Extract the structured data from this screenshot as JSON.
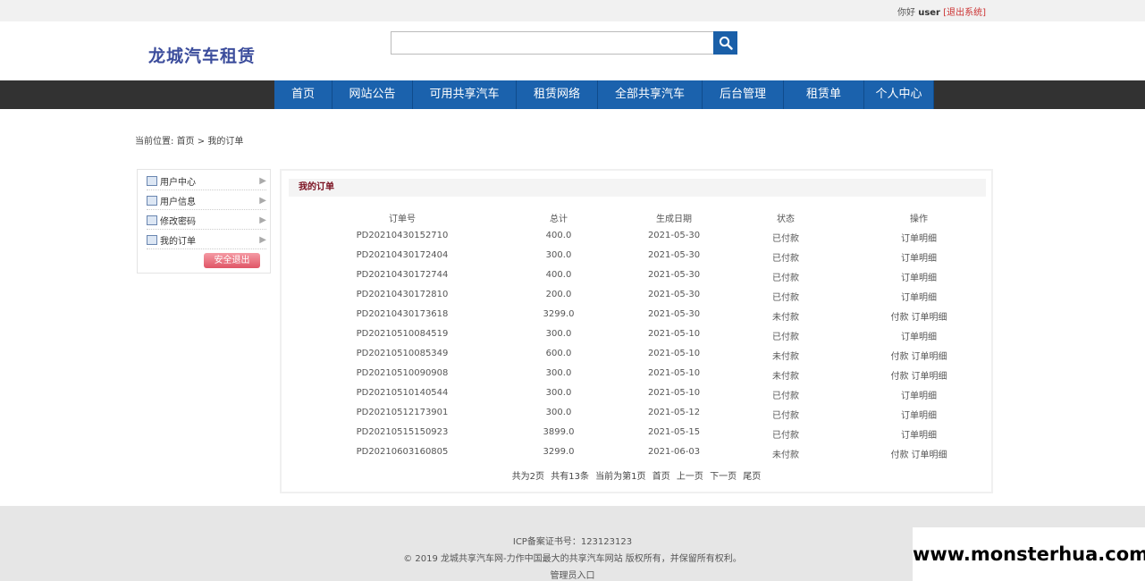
{
  "topbar": {
    "greeting": "你好",
    "username": "user",
    "logout_label": "[退出系统]"
  },
  "site": {
    "logo": "龙城汽车租赁"
  },
  "search": {
    "value": "",
    "placeholder": ""
  },
  "nav": {
    "items": [
      "首页",
      "网站公告",
      "可用共享汽车",
      "租赁网络",
      "全部共享汽车",
      "后台管理",
      "租赁单",
      "个人中心"
    ]
  },
  "breadcrumb": {
    "prefix": "当前位置:",
    "home": "首页",
    "sep": ">",
    "current": "我的订单"
  },
  "sidebar": {
    "items": [
      "用户中心",
      "用户信息",
      "修改密码",
      "我的订单"
    ],
    "exit_label": "安全退出"
  },
  "orders": {
    "title": "我的订单",
    "columns": [
      "订单号",
      "总计",
      "生成日期",
      "状态",
      "操作"
    ],
    "pay_label": "付款",
    "detail_label": "订单明细",
    "rows": [
      {
        "id": "PD20210430152710",
        "total": "400.0",
        "date": "2021-05-30",
        "status": "已付款",
        "can_pay": false
      },
      {
        "id": "PD20210430172404",
        "total": "300.0",
        "date": "2021-05-30",
        "status": "已付款",
        "can_pay": false
      },
      {
        "id": "PD20210430172744",
        "total": "400.0",
        "date": "2021-05-30",
        "status": "已付款",
        "can_pay": false
      },
      {
        "id": "PD20210430172810",
        "total": "200.0",
        "date": "2021-05-30",
        "status": "已付款",
        "can_pay": false
      },
      {
        "id": "PD20210430173618",
        "total": "3299.0",
        "date": "2021-05-30",
        "status": "未付款",
        "can_pay": true
      },
      {
        "id": "PD20210510084519",
        "total": "300.0",
        "date": "2021-05-10",
        "status": "已付款",
        "can_pay": false
      },
      {
        "id": "PD20210510085349",
        "total": "600.0",
        "date": "2021-05-10",
        "status": "未付款",
        "can_pay": true
      },
      {
        "id": "PD20210510090908",
        "total": "300.0",
        "date": "2021-05-10",
        "status": "未付款",
        "can_pay": true
      },
      {
        "id": "PD20210510140544",
        "total": "300.0",
        "date": "2021-05-10",
        "status": "已付款",
        "can_pay": false
      },
      {
        "id": "PD20210512173901",
        "total": "300.0",
        "date": "2021-05-12",
        "status": "已付款",
        "can_pay": false
      },
      {
        "id": "PD20210515150923",
        "total": "3899.0",
        "date": "2021-05-15",
        "status": "已付款",
        "can_pay": false
      },
      {
        "id": "PD20210603160805",
        "total": "3299.0",
        "date": "2021-06-03",
        "status": "未付款",
        "can_pay": true
      }
    ]
  },
  "pager": {
    "total_pages": "共为2页",
    "total_items": "共有13条",
    "current": "当前为第1页",
    "first": "首页",
    "prev": "上一页",
    "next": "下一页",
    "last": "尾页"
  },
  "footer": {
    "icp": "ICP备案证书号：123123123",
    "copyright": "© 2019 龙城共享汽车网-力作中国最大的共享汽车网站 版权所有，并保留所有权利。",
    "admin_link": "管理员入口"
  },
  "watermark": "www.monsterhua.com",
  "colors": {
    "nav_blue": "#1b62ad",
    "nav_bar": "#323232",
    "logo": "#3c4d9c",
    "title_red": "#7a1020"
  }
}
